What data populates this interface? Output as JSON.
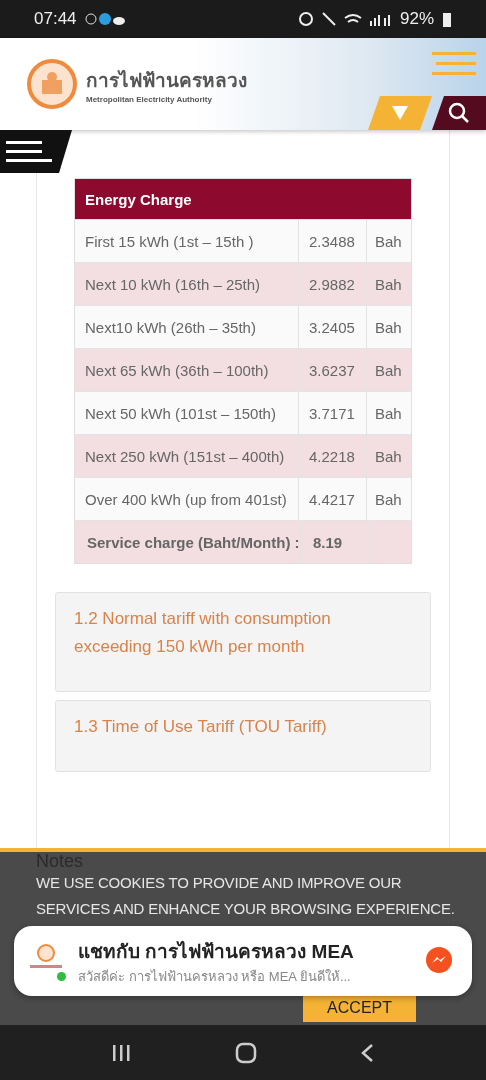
{
  "status_bar": {
    "time": "07:44",
    "battery": "92%"
  },
  "header": {
    "title": "การไฟฟ้านครหลวง",
    "subtitle": "Metropolitan Electricity Authority"
  },
  "table": {
    "heading": "Energy Charge",
    "rows": [
      {
        "label": "First 15 kWh (1st – 15th )",
        "rate": "2.3488",
        "unit": "Bah"
      },
      {
        "label": "Next 10 kWh (16th – 25th)",
        "rate": "2.9882",
        "unit": "Bah"
      },
      {
        "label": "Next10 kWh (26th – 35th)",
        "rate": "3.2405",
        "unit": "Bah"
      },
      {
        "label": "Next 65 kWh (36th – 100th)",
        "rate": "3.6237",
        "unit": "Bah"
      },
      {
        "label": "Next 50 kWh (101st – 150th)",
        "rate": "3.7171",
        "unit": "Bah"
      },
      {
        "label": "Next 250 kWh (151st – 400th)",
        "rate": "4.2218",
        "unit": "Bah"
      },
      {
        "label": "Over 400 kWh (up from 401st)",
        "rate": "4.4217",
        "unit": "Bah"
      }
    ],
    "footer": {
      "label": "Service charge (Baht/Month) :",
      "rate": "8.19"
    }
  },
  "sections": [
    {
      "title": "1.2 Normal tariff with consumption exceeding 150 kWh per month"
    },
    {
      "title": "1.3 Time of Use Tariff (TOU Tariff)"
    }
  ],
  "notes_heading": "Notes",
  "cookie_banner": {
    "text": "WE USE COOKIES TO PROVIDE AND IMPROVE OUR SERVICES AND ENHANCE YOUR BROWSING EXPERIENCE.",
    "button": "ACCEPT"
  },
  "chat_popup": {
    "title": "แชทกับ การไฟฟ้านครหลวง MEA",
    "message": "สวัสดีค่ะ การไฟฟ้านครหลวง หรือ MEA ยินดีให้...",
    "online": true
  }
}
